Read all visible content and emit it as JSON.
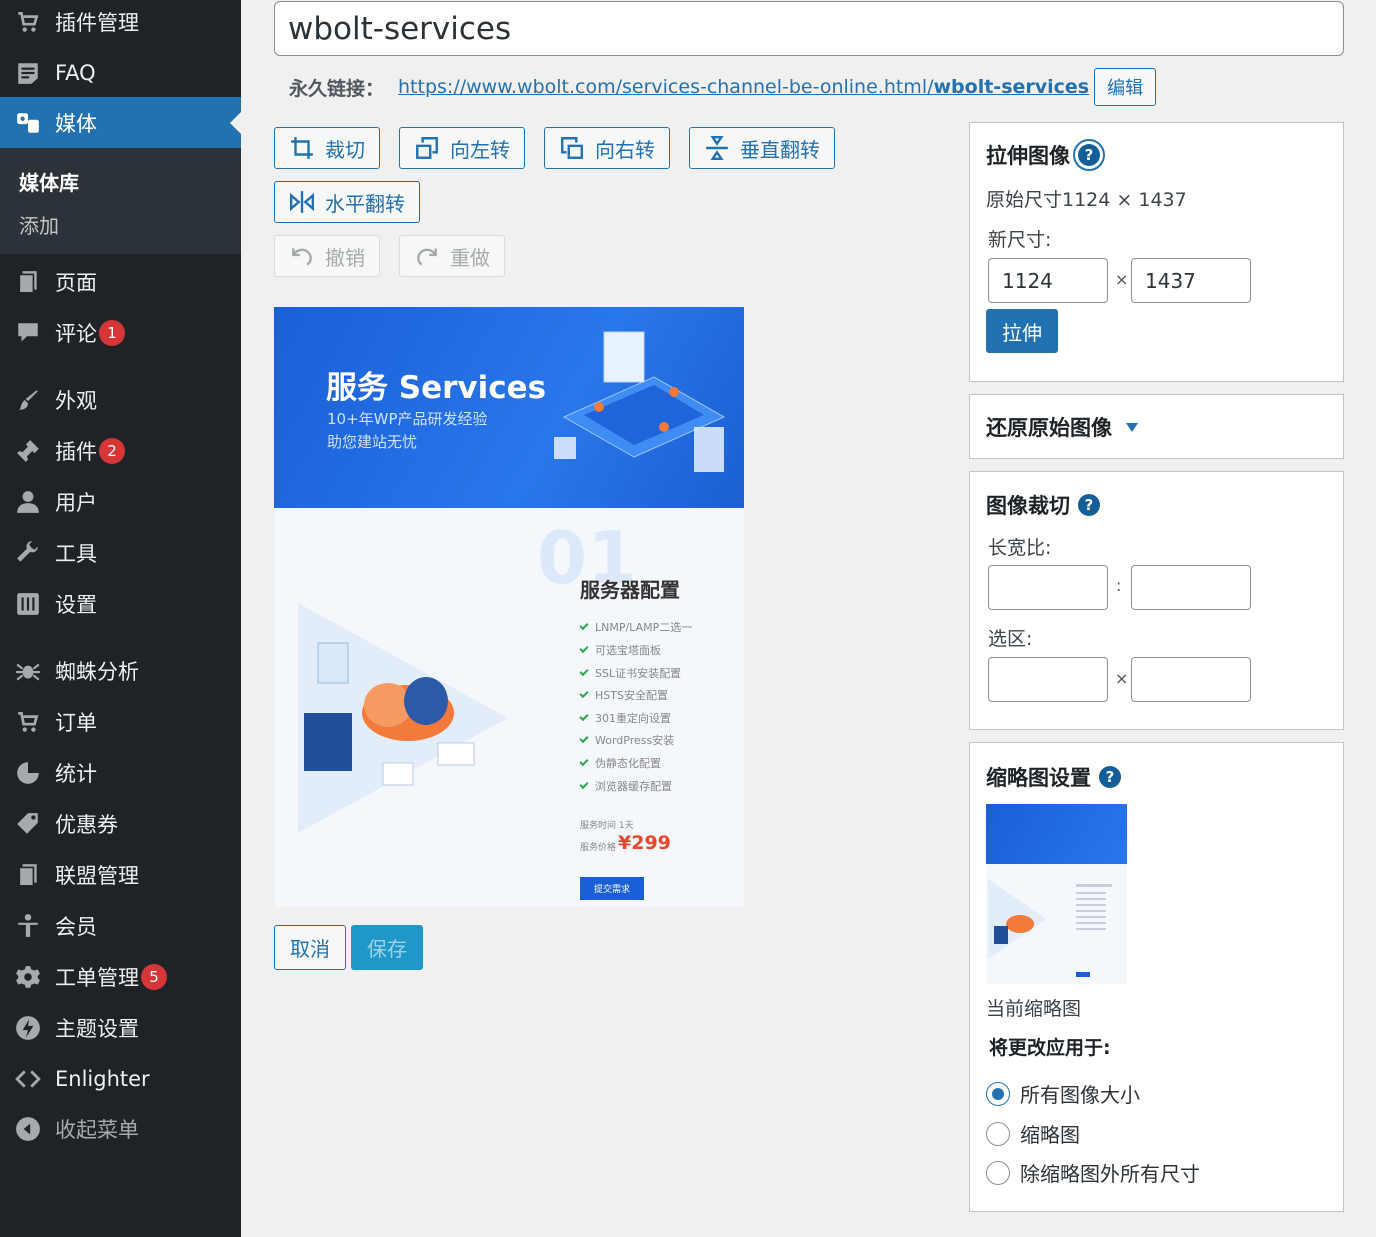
{
  "sidebar": {
    "items": [
      {
        "label": "插件管理",
        "icon": "cart-icon"
      },
      {
        "label": "FAQ",
        "icon": "faq-icon"
      },
      {
        "label": "媒体",
        "icon": "media-icon"
      },
      {
        "label": "页面",
        "icon": "page-icon"
      },
      {
        "label": "评论",
        "icon": "comment-icon",
        "badge": "1"
      },
      {
        "label": "外观",
        "icon": "appearance-icon"
      },
      {
        "label": "插件",
        "icon": "plugin-icon",
        "badge": "2"
      },
      {
        "label": "用户",
        "icon": "user-icon"
      },
      {
        "label": "工具",
        "icon": "wrench-icon"
      },
      {
        "label": "设置",
        "icon": "settings-icon"
      },
      {
        "label": "蜘蛛分析",
        "icon": "spider-icon"
      },
      {
        "label": "订单",
        "icon": "cart-icon"
      },
      {
        "label": "统计",
        "icon": "chart-pie-icon"
      },
      {
        "label": "优惠券",
        "icon": "coupon-icon"
      },
      {
        "label": "联盟管理",
        "icon": "page-icon"
      },
      {
        "label": "会员",
        "icon": "member-icon"
      },
      {
        "label": "工单管理",
        "icon": "gear-icon",
        "badge": "5"
      },
      {
        "label": "主题设置",
        "icon": "bolt-icon"
      },
      {
        "label": "Enlighter",
        "icon": "code-icon"
      },
      {
        "label": "收起菜单",
        "icon": "collapse-icon"
      }
    ],
    "submenu": [
      "媒体库",
      "添加"
    ]
  },
  "editor": {
    "title": "wbolt-services",
    "permalink_label": "永久链接：",
    "permalink_base": "https://www.wbolt.com/services-channel-be-online.html/",
    "permalink_slug": "wbolt-services",
    "edit_label": "编辑",
    "tools": {
      "crop": "裁切",
      "rotate_left": "向左转",
      "rotate_right": "向右转",
      "flip_vertical": "垂直翻转",
      "flip_horizontal": "水平翻转",
      "undo": "撤销",
      "redo": "重做"
    },
    "cancel": "取消",
    "save": "保存"
  },
  "preview": {
    "title": "服务 Services",
    "sub1": "10+年WP产品研发经验",
    "sub2": "助您建站无忧",
    "number": "01",
    "heading": "服务器配置",
    "features": [
      "LNMP/LAMP二选一",
      "可选宝塔面板",
      "SSL证书安装配置",
      "HSTS安全配置",
      "301重定向设置",
      "WordPress安装",
      "伪静态化配置",
      "浏览器缓存配置"
    ],
    "meta1": "服务时间  1天",
    "meta2": "服务价格",
    "price": "¥299",
    "button": "提交需求"
  },
  "scale": {
    "title": "拉伸图像",
    "help": "?",
    "original": "原始尺寸1124 × 1437",
    "new_size": "新尺寸:",
    "width": "1124",
    "height": "1437",
    "x": "×",
    "button": "拉伸"
  },
  "restore": {
    "title": "还原原始图像"
  },
  "crop": {
    "title": "图像裁切",
    "help": "?",
    "aspect": "长宽比:",
    "colon": ":",
    "selection": "选区:",
    "x": "×"
  },
  "thumbnail": {
    "title": "缩略图设置",
    "help": "?",
    "current": "当前缩略图",
    "apply_to": "将更改应用于:",
    "options": [
      "所有图像大小",
      "缩略图",
      "除缩略图外所有尺寸"
    ],
    "selected_index": 0
  },
  "colors": {
    "accent": "#2271b1",
    "sidebar": "#1d2327",
    "badge": "#d63638"
  }
}
